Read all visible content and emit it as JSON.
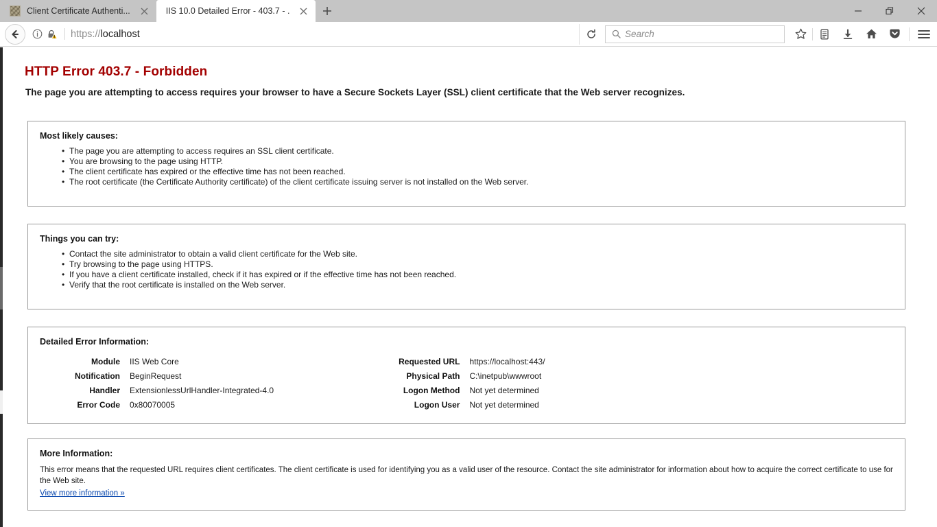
{
  "browser": {
    "tabs": [
      {
        "title": "Client Certificate Authenti...",
        "active": false,
        "favicon": "generic-site-favicon",
        "close_label": "close-tab"
      },
      {
        "title": "IIS 10.0 Detailed Error - 403.7 - ...",
        "active": true,
        "favicon": "none",
        "close_label": "close-tab"
      }
    ],
    "new_tab_label": "+",
    "window_controls": {
      "minimize": "—",
      "restore": "❐",
      "close": "✕"
    },
    "nav": {
      "back_label": "Back",
      "identity_icons": [
        "info-circle-icon",
        "insecure-padlock-warning-icon"
      ],
      "url_scheme": "https://",
      "url_host": "localhost",
      "reload_label": "Reload",
      "search_placeholder": "Search",
      "toolbar_icons": [
        "bookmark-star-icon",
        "library-icon",
        "downloads-icon",
        "home-icon",
        "pocket-icon",
        "hamburger-menu-icon"
      ]
    }
  },
  "page": {
    "title": "HTTP Error 403.7 - Forbidden",
    "subtitle": "The page you are attempting to access requires your browser to have a Secure Sockets Layer (SSL) client certificate that the Web server recognizes.",
    "causes": {
      "heading": "Most likely causes:",
      "items": [
        "The page you are attempting to access requires an SSL client certificate.",
        "You are browsing to the page using HTTP.",
        "The client certificate has expired or the effective time has not been reached.",
        "The root certificate (the Certificate Authority certificate) of the client certificate issuing server is not installed on the Web server."
      ]
    },
    "try": {
      "heading": "Things you can try:",
      "items": [
        "Contact the site administrator to obtain a valid client certificate for the Web site.",
        "Try browsing to the page using HTTPS.",
        "If you have a client certificate installed, check if it has expired or if the effective time has not been reached.",
        "Verify that the root certificate is installed on the Web server."
      ]
    },
    "details": {
      "heading": "Detailed Error Information:",
      "left": [
        {
          "label": "Module",
          "value": "IIS Web Core"
        },
        {
          "label": "Notification",
          "value": "BeginRequest"
        },
        {
          "label": "Handler",
          "value": "ExtensionlessUrlHandler-Integrated-4.0"
        },
        {
          "label": "Error Code",
          "value": "0x80070005"
        }
      ],
      "right": [
        {
          "label": "Requested URL",
          "value": "https://localhost:443/"
        },
        {
          "label": "Physical Path",
          "value": "C:\\inetpub\\wwwroot"
        },
        {
          "label": "Logon Method",
          "value": "Not yet determined"
        },
        {
          "label": "Logon User",
          "value": "Not yet determined"
        }
      ]
    },
    "more": {
      "heading": "More Information:",
      "body": "This error means that the requested URL requires client certificates. The client certificate is used for identifying you as a valid user of the resource. Contact the site administrator for information about how to acquire the correct certificate to use for the Web site.",
      "link": "View more information »"
    }
  },
  "colors": {
    "error_red": "#a30000",
    "link_blue": "#0645ad",
    "panel_border": "#999999",
    "chrome_tabbar": "#c5c5c5"
  }
}
